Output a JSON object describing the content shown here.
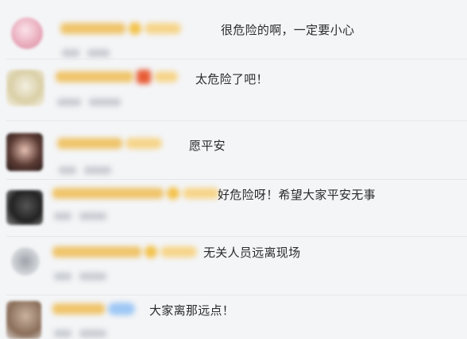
{
  "comments": [
    {
      "text": "很危险的啊，一定要小心"
    },
    {
      "text": "太危险了吧！"
    },
    {
      "text": "愿平安"
    },
    {
      "text": "好危险呀！希望大家平安无事"
    },
    {
      "text": "无关人员远离现场"
    },
    {
      "text": "大家离那远点！"
    }
  ],
  "colors": {
    "username": "#e9b64a",
    "level_badge": "#f6d58a",
    "verified_badge": "#9fc8f5",
    "text": "#2b2b2b",
    "background": "#f4f5f7"
  },
  "icons": [
    "user-avatar",
    "vip-badge-icon",
    "level-badge-icon"
  ]
}
